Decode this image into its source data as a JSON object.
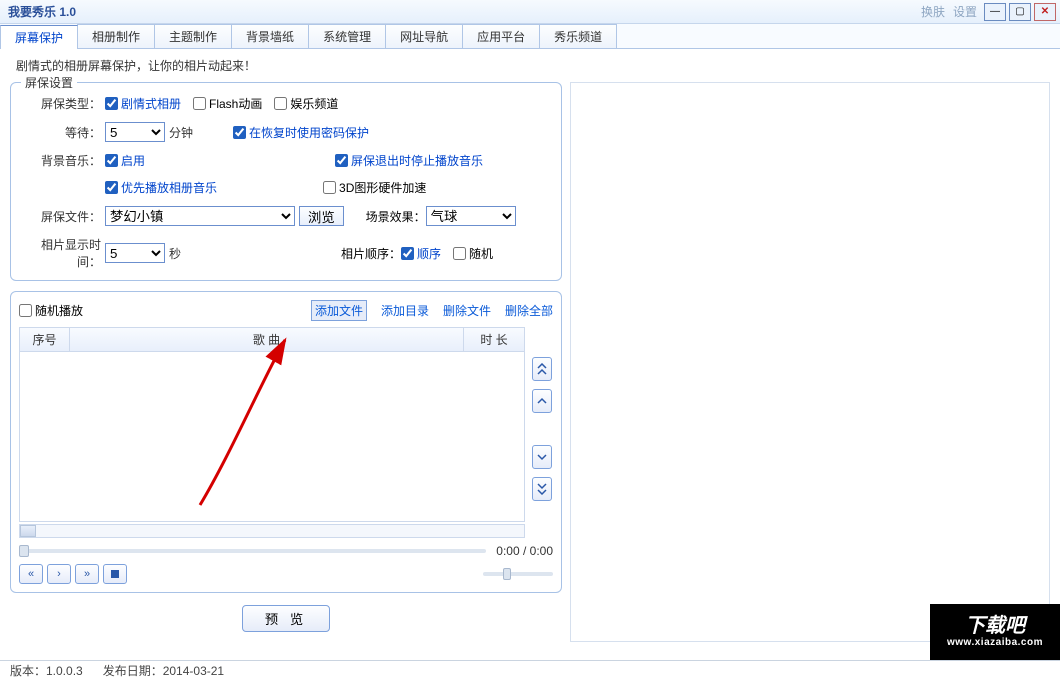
{
  "title": "我要秀乐 1.0",
  "title_links": {
    "skin": "换肤",
    "settings": "设置"
  },
  "tabs": [
    "屏幕保护",
    "相册制作",
    "主题制作",
    "背景墙纸",
    "系统管理",
    "网址导航",
    "应用平台",
    "秀乐频道"
  ],
  "active_tab_index": 0,
  "top_hint": "剧情式的相册屏幕保护，让你的相片动起来！",
  "group_settings_title": "屏保设置",
  "labels": {
    "type": "屏保类型：",
    "wait": "等待：",
    "wait_unit": "分钟",
    "bgmusic": "背景音乐：",
    "file": "屏保文件：",
    "photo_time": "相片显示时间：",
    "photo_time_unit": "秒",
    "scene": "场景效果：",
    "order": "相片顺序："
  },
  "type_opts": {
    "story": "剧情式相册",
    "flash": "Flash动画",
    "ent": "娱乐频道"
  },
  "checks": {
    "enable": "启用",
    "prefer_album": "优先播放相册音乐",
    "pwd_on_resume": "在恢复时使用密码保护",
    "stop_music_on_exit": "屏保退出时停止播放音乐",
    "hw3d": "3D图形硬件加速",
    "order_seq": "顺序",
    "order_rand": "随机"
  },
  "wait_value": "5",
  "file_value": "梦幻小镇",
  "browse": "浏览",
  "scene_value": "气球",
  "photo_time_value": "5",
  "playlist": {
    "shuffle": "随机播放",
    "add_file": "添加文件",
    "add_dir": "添加目录",
    "del_file": "删除文件",
    "del_all": "删除全部",
    "col_idx": "序号",
    "col_song": "歌 曲",
    "col_dur": "时 长",
    "time": "0:00 / 0:00"
  },
  "preview": "预  览",
  "status": {
    "version": "版本：1.0.0.3",
    "date": "发布日期：2014-03-21"
  },
  "watermark": {
    "big": "下载吧",
    "url": "www.xiazaiba.com"
  }
}
